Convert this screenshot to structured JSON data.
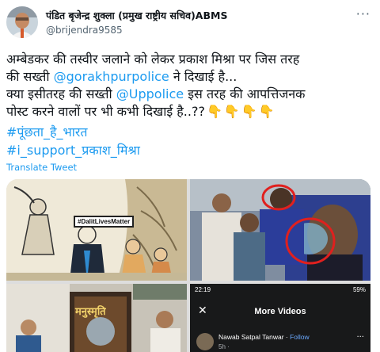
{
  "tweet": {
    "author_name": "पंडित बृजेन्द्र शुक्ला (प्रमुख राष्ट्रीय सचिव)ABMS",
    "author_handle": "@brijendra9585",
    "more_icon": "more-horizontal-icon",
    "text": {
      "line1": "अम्बेडकर की तस्वीर जलाने को लेकर प्रकाश मिश्रा पर जिस तरह",
      "line2_pre": "की सख्ती ",
      "mention1": "@gorakhpurpolice",
      "line2_post": " ने दिखाई है...",
      "line3_pre": "क्या इसीतरह की सख्ती ",
      "mention2": "@Uppolice",
      "line3_post": " इस तरह की आपत्तिजनक",
      "line4": "पोस्ट करने वालों पर भी कभी दिखाई है..??"
    },
    "emojis": [
      "👇",
      "👇",
      "👇",
      "👇"
    ],
    "hashtags": [
      "#पूंछता_है_भारत",
      "#i_support_प्रकाश_मिश्रा"
    ],
    "translate_label": "Translate Tweet"
  },
  "media": {
    "image1_caption": "#DalitLivesMatter",
    "image3_title": "मनुस्मृति",
    "image4": {
      "status_time": "22:19",
      "status_right": "59%",
      "header_title": "More Videos",
      "user_name": "Nawab Satpal Tanwar",
      "follow_label": "Follow",
      "separator": " · ",
      "time_ago": "5h ·",
      "close_icon": "close-icon",
      "more_icon": "more-horizontal-icon"
    }
  },
  "colors": {
    "link": "#1d9bf0",
    "text": "#0f1419",
    "muted": "#536471"
  }
}
